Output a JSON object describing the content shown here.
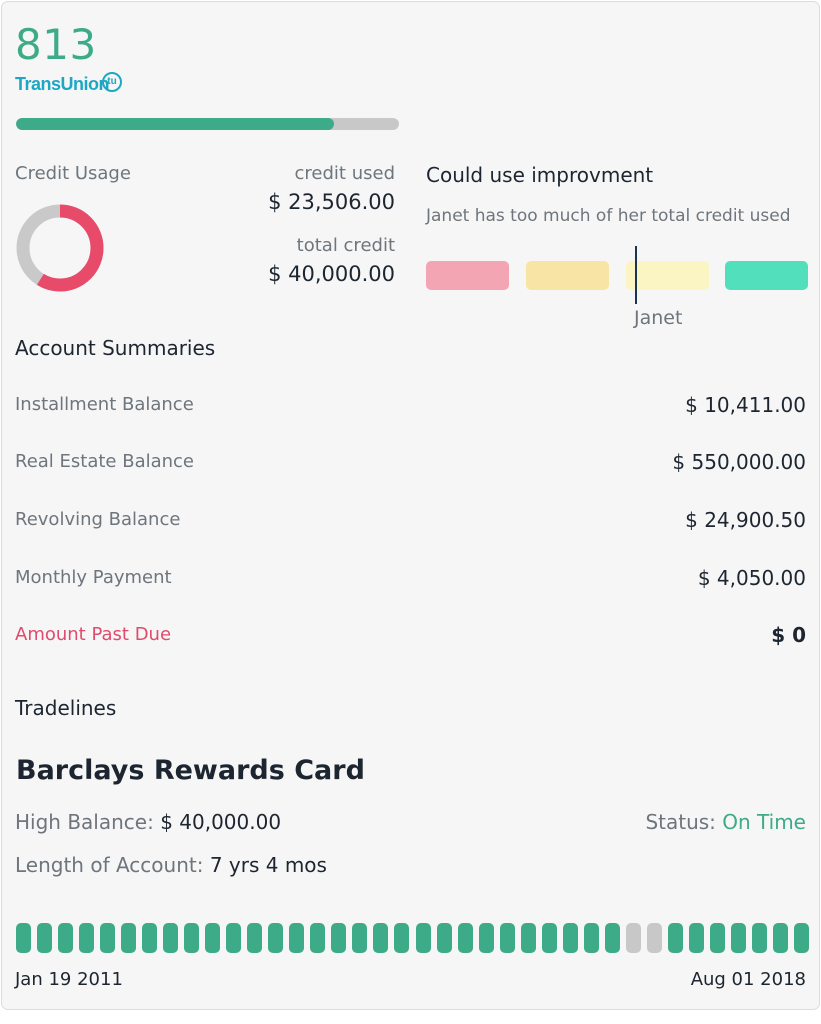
{
  "score": "813",
  "bureau": {
    "name": "TransUnion",
    "badge": "tu"
  },
  "score_progress": 0.83,
  "credit_usage": {
    "title": "Credit Usage",
    "used_label": "credit used",
    "used_value": "$ 23,506.00",
    "total_label": "total credit",
    "total_value": "$ 40,000.00",
    "used_fraction": 0.588,
    "colors": {
      "used": "#e84a6a",
      "remaining": "#c9c9c9"
    }
  },
  "assessment": {
    "title": "Could use improvment",
    "message": "Janet has too much of her total credit used",
    "marker_label": "Janet",
    "scale_colors": [
      "#f3a5b3",
      "#f8e5a6",
      "#fbf5c3",
      "#52e0bc"
    ]
  },
  "account_summaries": {
    "title": "Account Summaries",
    "rows": [
      {
        "label": "Installment Balance",
        "value": "$ 10,411.00"
      },
      {
        "label": "Real Estate Balance",
        "value": "$ 550,000.00"
      },
      {
        "label": "Revolving Balance",
        "value": "$ 24,900.50"
      },
      {
        "label": "Monthly Payment",
        "value": "$ 4,050.00"
      },
      {
        "label": "Amount Past Due",
        "value": "$ 0"
      }
    ]
  },
  "tradelines": {
    "title": "Tradelines",
    "account": {
      "name": "Barclays Rewards Card",
      "high_balance_label": "High Balance:",
      "high_balance_value": "$ 40,000.00",
      "status_label": "Status:",
      "status_value": "On Time",
      "length_label": "Length of Account:",
      "length_value": "7 yrs 4 mos",
      "start_date": "Jan 19 2011",
      "end_date": "Aug 01 2018",
      "payment_history": [
        "on-time",
        "on-time",
        "on-time",
        "on-time",
        "on-time",
        "on-time",
        "on-time",
        "on-time",
        "on-time",
        "on-time",
        "on-time",
        "on-time",
        "on-time",
        "on-time",
        "on-time",
        "on-time",
        "on-time",
        "on-time",
        "on-time",
        "on-time",
        "on-time",
        "on-time",
        "on-time",
        "on-time",
        "on-time",
        "on-time",
        "on-time",
        "on-time",
        "on-time",
        "none",
        "none",
        "on-time",
        "on-time",
        "on-time",
        "on-time",
        "on-time",
        "on-time",
        "on-time"
      ],
      "history_colors": {
        "on-time": "#3daa88",
        "none": "#c8c8c8"
      }
    }
  }
}
